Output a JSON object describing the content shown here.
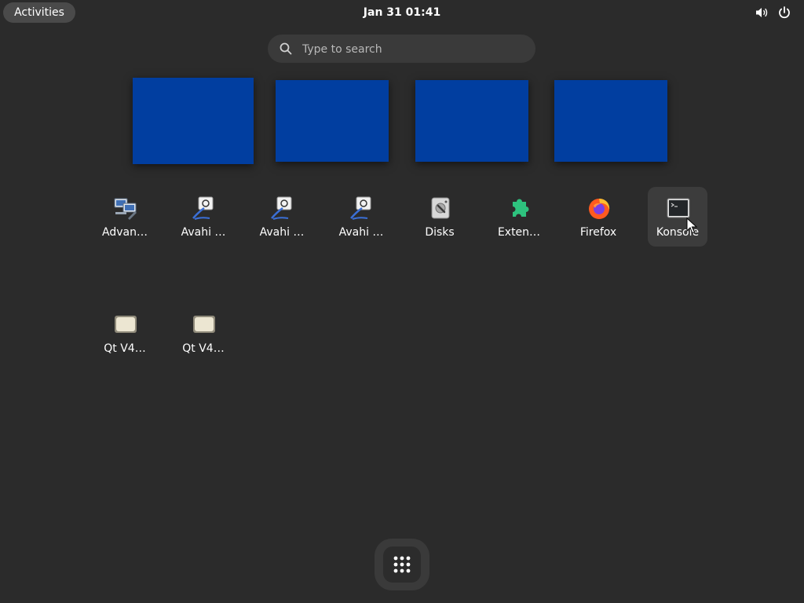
{
  "topbar": {
    "activities_label": "Activities",
    "clock": "Jan 31  01:41",
    "icons": [
      "volume-icon",
      "power-icon"
    ]
  },
  "search": {
    "placeholder": "Type to search",
    "value": ""
  },
  "workspaces": {
    "count": 4,
    "background_color": "#013ea0"
  },
  "apps": [
    {
      "label": "Advan…",
      "icon": "advanced-network-icon"
    },
    {
      "label": "Avahi …",
      "icon": "avahi-icon"
    },
    {
      "label": "Avahi …",
      "icon": "avahi-icon"
    },
    {
      "label": "Avahi …",
      "icon": "avahi-icon"
    },
    {
      "label": "Disks",
      "icon": "disks-icon"
    },
    {
      "label": "Exten…",
      "icon": "extensions-icon"
    },
    {
      "label": "Firefox",
      "icon": "firefox-icon"
    },
    {
      "label": "Konsole",
      "icon": "konsole-icon"
    },
    {
      "label": "Qt V4…",
      "icon": "qt-v4l2-icon"
    },
    {
      "label": "Qt V4…",
      "icon": "qt-v4l2-icon"
    }
  ],
  "dash": {
    "show_apps_icon": "app-grid-icon"
  },
  "colors": {
    "background": "#2b2b2b",
    "extensions_green": "#2ec27e"
  }
}
